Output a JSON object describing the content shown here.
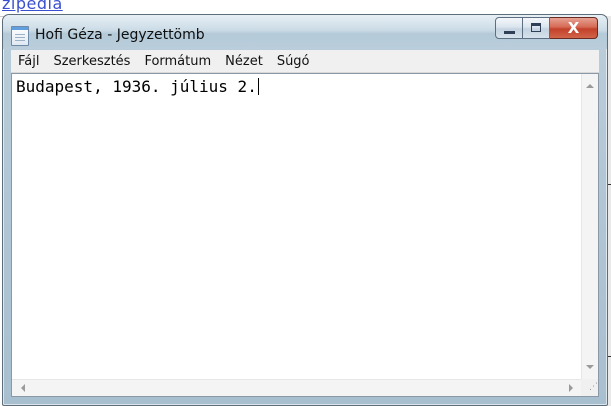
{
  "background": {
    "fragment_text": "zipédia"
  },
  "window": {
    "title": "Hofi Géza - Jegyzettömb",
    "app_icon": "notepad-icon",
    "caption_buttons": {
      "minimize_icon": "minimize-icon",
      "maximize_icon": "maximize-icon",
      "close_label": "X"
    }
  },
  "menu": {
    "items": [
      {
        "label": "Fájl"
      },
      {
        "label": "Szerkesztés"
      },
      {
        "label": "Formátum"
      },
      {
        "label": "Nézet"
      },
      {
        "label": "Súgó"
      }
    ]
  },
  "editor": {
    "content": "Budapest, 1936. július 2."
  },
  "colors": {
    "close_button": "#c3412a",
    "title_bar": "#cbdbe6",
    "link_fragment": "#3a4fd0"
  }
}
